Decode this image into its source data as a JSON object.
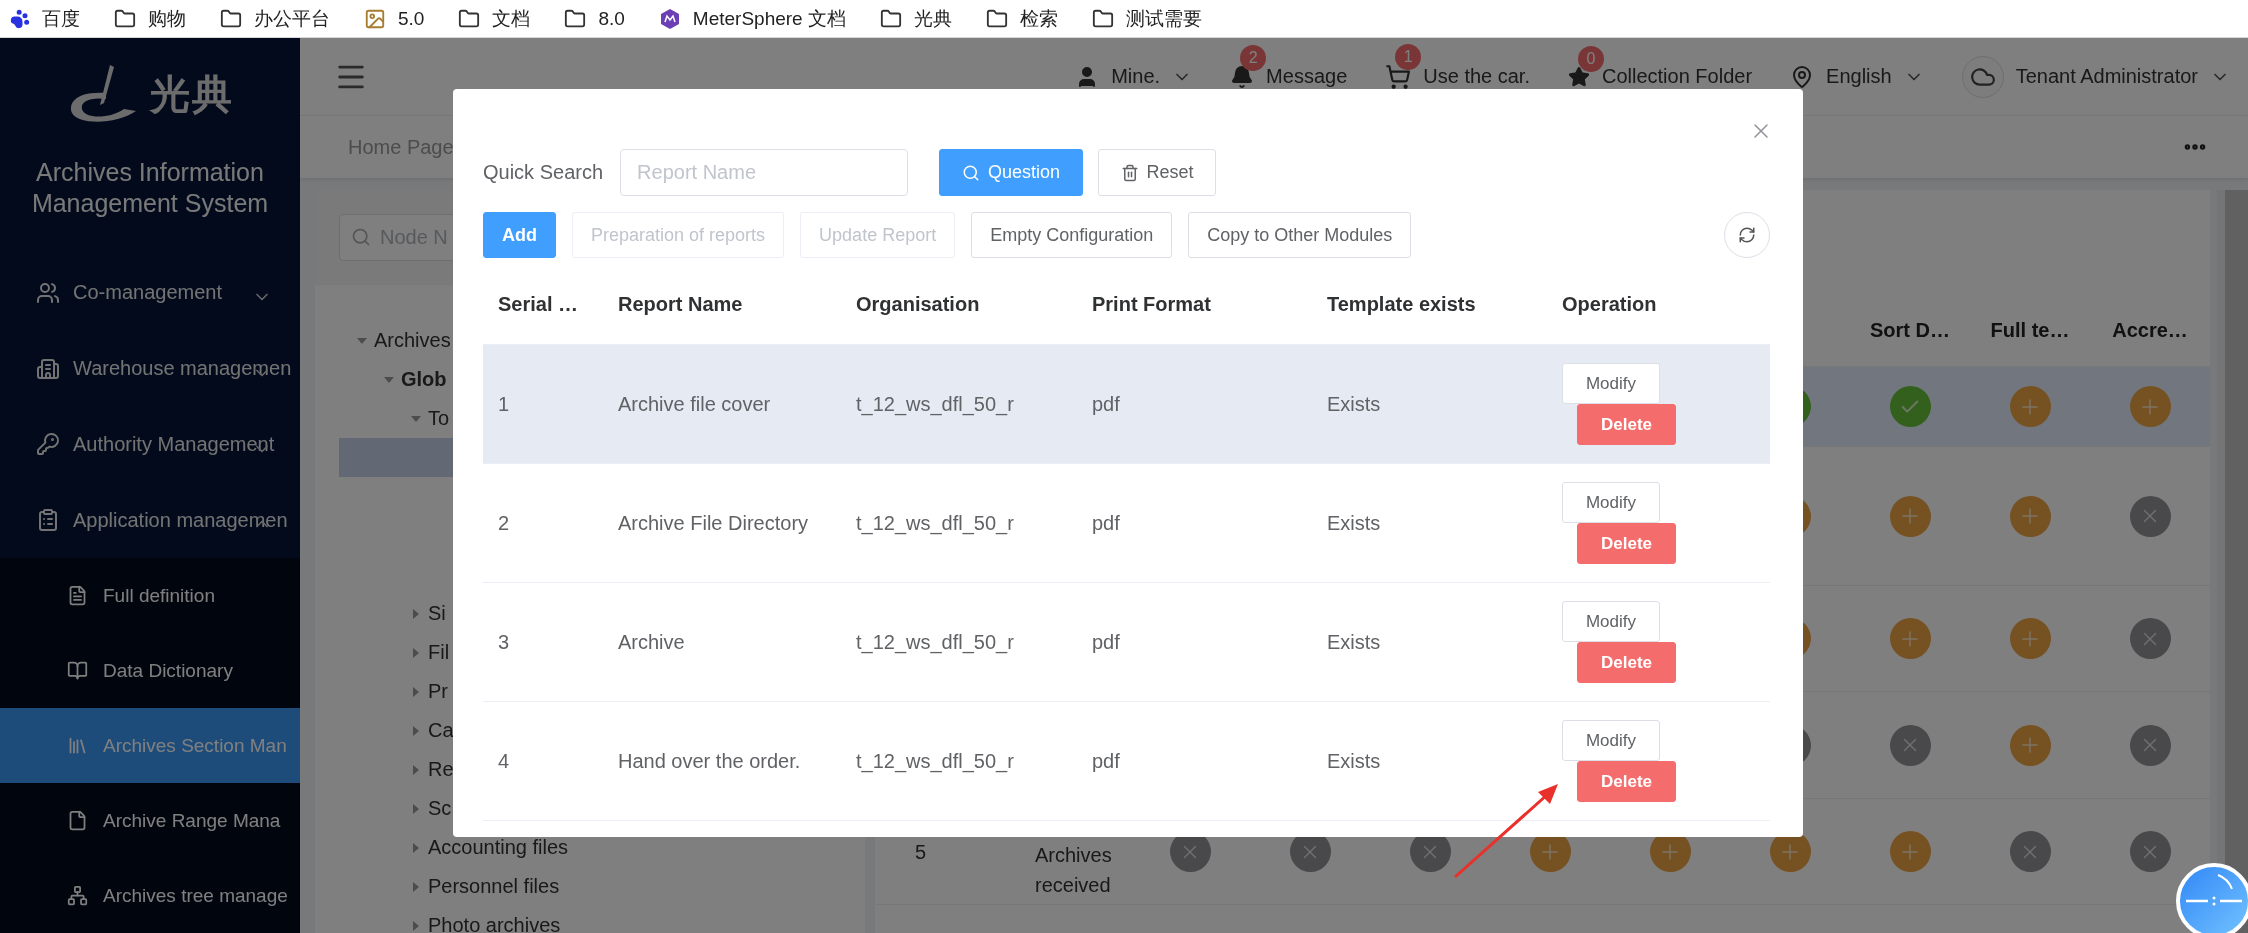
{
  "bookmarks": [
    {
      "kind": "paw",
      "label": "百度"
    },
    {
      "kind": "folder",
      "label": "购物"
    },
    {
      "kind": "folder",
      "label": "办公平台"
    },
    {
      "kind": "image",
      "label": "5.0"
    },
    {
      "kind": "folder",
      "label": "文档"
    },
    {
      "kind": "folder",
      "label": "8.0"
    },
    {
      "kind": "app",
      "label": "MeterSphere 文档"
    },
    {
      "kind": "folder",
      "label": "光典"
    },
    {
      "kind": "folder",
      "label": "检索"
    },
    {
      "kind": "folder",
      "label": "测试需要"
    }
  ],
  "sidebar": {
    "logo_text": "光典",
    "title": "Archives Information Management System",
    "items": [
      {
        "kind": "users",
        "label": "Co-management",
        "expanded": false
      },
      {
        "kind": "building",
        "label": "Warehouse managemen",
        "expanded": false
      },
      {
        "kind": "key",
        "label": "Authority Management",
        "expanded": false
      },
      {
        "kind": "clipboard",
        "label": "Application managemen",
        "expanded": true,
        "children": [
          {
            "kind": "list",
            "label": "Full definition",
            "selected": false
          },
          {
            "kind": "book",
            "label": "Data Dictionary",
            "selected": false
          },
          {
            "kind": "books",
            "label": "Archives Section Man",
            "selected": true
          },
          {
            "kind": "file",
            "label": "Archive Range Mana",
            "selected": false
          },
          {
            "kind": "tree",
            "label": "Archives tree manage",
            "selected": false
          }
        ]
      }
    ]
  },
  "header": {
    "user": "Mine.",
    "notices": [
      {
        "kind": "bell",
        "label": "Message",
        "badge": "2"
      },
      {
        "kind": "cart",
        "label": "Use the car.",
        "badge": "1"
      },
      {
        "kind": "star",
        "label": "Collection Folder",
        "badge": "0"
      }
    ],
    "language": "English",
    "account": "Tenant Administrator"
  },
  "breadcrumb": "Home Page",
  "tree": {
    "search_placeholder": "Node N",
    "nodes": [
      {
        "label": "Archives",
        "expanded": true,
        "children": [
          {
            "label": "Glob",
            "bold": true,
            "expanded": true,
            "children": [
              {
                "label": "To",
                "expanded": true,
                "children": [
                  {
                    "selected": true
                  },
                  {
                    "selected": false
                  },
                  {
                    "selected": false
                  },
                  {
                    "selected": false
                  }
                ]
              },
              {
                "label": "Si",
                "expanded": false
              },
              {
                "label": "Fil",
                "expanded": false
              },
              {
                "label": "Pr",
                "expanded": false
              },
              {
                "label": "Ca",
                "expanded": false
              },
              {
                "label": "Re",
                "expanded": false
              },
              {
                "label": "Sc",
                "expanded": false
              },
              {
                "label": "Accounting files",
                "expanded": false
              },
              {
                "label": "Personnel files",
                "expanded": false
              },
              {
                "label": "Photo archives",
                "expanded": false
              }
            ]
          }
        ]
      }
    ]
  },
  "records_table": {
    "headers": [
      "Sort D…",
      "Full te…",
      "Accre…"
    ],
    "rows": [
      {
        "selected": true,
        "statuses": [
          {
            "kind": "check"
          },
          {
            "kind": "check"
          },
          {
            "kind": "plus"
          },
          {
            "kind": "plus"
          }
        ]
      },
      {
        "selected": false,
        "statuses": [
          {
            "kind": "plus"
          },
          {
            "kind": "plus"
          },
          {
            "kind": "plus"
          },
          {
            "kind": "cross"
          }
        ]
      },
      {
        "selected": false,
        "statuses": [
          {
            "kind": "plus"
          },
          {
            "kind": "plus"
          },
          {
            "kind": "plus"
          },
          {
            "kind": "cross"
          }
        ]
      },
      {
        "selected": false,
        "statuses": [
          {
            "kind": "cross"
          },
          {
            "kind": "cross"
          },
          {
            "kind": "plus"
          },
          {
            "kind": "cross"
          }
        ]
      },
      {
        "selected": false,
        "serial": "5",
        "name": "Archives received",
        "statuses": [
          {
            "kind": "cross"
          },
          {
            "kind": "cross"
          },
          {
            "kind": "cross"
          },
          {
            "kind": "plus"
          },
          {
            "kind": "plus"
          },
          {
            "kind": "plus"
          },
          {
            "kind": "plus"
          },
          {
            "kind": "cross"
          },
          {
            "kind": "cross"
          }
        ]
      }
    ]
  },
  "dialog": {
    "search_label": "Quick Search",
    "search_placeholder": "Report Name",
    "search_button": "Question",
    "reset_button": "Reset",
    "actions": [
      {
        "label": "Add",
        "kind": "primary",
        "disabled": false
      },
      {
        "label": "Preparation of reports",
        "kind": "plain",
        "disabled": true
      },
      {
        "label": "Update Report",
        "kind": "plain",
        "disabled": true
      },
      {
        "label": "Empty Configuration",
        "kind": "plain",
        "disabled": false
      },
      {
        "label": "Copy to Other Modules",
        "kind": "plain",
        "disabled": false
      }
    ],
    "columns": [
      "Serial …",
      "Report Name",
      "Organisation",
      "Print Format",
      "Template exists",
      "Operation"
    ],
    "rows": [
      {
        "selected": true,
        "cells": [
          "1",
          "Archive file cover",
          "t_12_ws_dfl_50_r",
          "pdf",
          "Exists"
        ],
        "buttons": [
          "Modify",
          "Delete"
        ]
      },
      {
        "selected": false,
        "cells": [
          "2",
          "Archive File Directory",
          "t_12_ws_dfl_50_r",
          "pdf",
          "Exists"
        ],
        "buttons": [
          "Modify",
          "Delete"
        ]
      },
      {
        "selected": false,
        "cells": [
          "3",
          "Archive",
          "t_12_ws_dfl_50_r",
          "pdf",
          "Exists"
        ],
        "buttons": [
          "Modify",
          "Delete"
        ]
      },
      {
        "selected": false,
        "cells": [
          "4",
          "Hand over the order.",
          "t_12_ws_dfl_50_r",
          "pdf",
          "Exists"
        ],
        "buttons": [
          "Modify",
          "Delete"
        ]
      }
    ]
  }
}
